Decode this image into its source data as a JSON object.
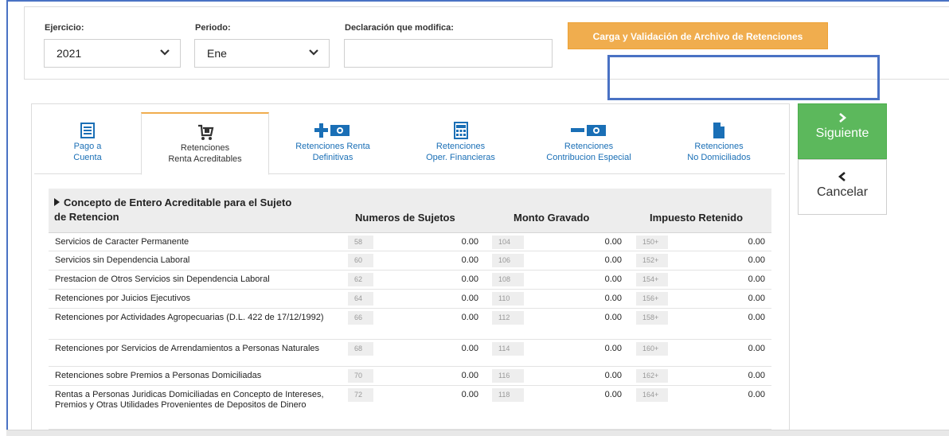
{
  "filters": {
    "ejercicio_label": "Ejercicio:",
    "ejercicio_value": "2021",
    "periodo_label": "Periodo:",
    "periodo_value": "Ene",
    "declaracion_label": "Declaración que modifica:",
    "declaracion_value": "",
    "carga_button": "Carga y Validación de Archivo de Retenciones"
  },
  "tabs": [
    {
      "line1": "Pago a",
      "line2": "Cuenta",
      "icon": "list-icon",
      "active": false
    },
    {
      "line1": "Retenciones",
      "line2": "Renta Acreditables",
      "icon": "cart-icon",
      "active": true
    },
    {
      "line1": "Retenciones Renta",
      "line2": "Definitivas",
      "icon": "plus-money-icon",
      "active": false
    },
    {
      "line1": "Retenciones",
      "line2": "Oper. Financieras",
      "icon": "calculator-icon",
      "active": false
    },
    {
      "line1": "Retenciones",
      "line2": "Contribucion Especial",
      "icon": "minus-money-icon",
      "active": false
    },
    {
      "line1": "Retenciones",
      "line2": "No Domiciliados",
      "icon": "file-icon",
      "active": false
    }
  ],
  "actions": {
    "next": "Siguiente",
    "cancel": "Cancelar"
  },
  "table": {
    "concept_header_1": "Concepto de Entero Acreditable para el Sujeto",
    "concept_header_2": "de Retencion",
    "col_sujetos": "Numeros de Sujetos",
    "col_monto": "Monto Gravado",
    "col_impuesto": "Impuesto Retenido",
    "rows": [
      {
        "concept": "Servicios de Caracter Permanente",
        "c1": "58",
        "v1": "0.00",
        "c2": "104",
        "v2": "0.00",
        "c3": "150+",
        "v3": "0.00"
      },
      {
        "concept": "Servicios sin Dependencia Laboral",
        "c1": "60",
        "v1": "0.00",
        "c2": "106",
        "v2": "0.00",
        "c3": "152+",
        "v3": "0.00"
      },
      {
        "concept": "Prestacion de Otros Servicios sin Dependencia Laboral",
        "c1": "62",
        "v1": "0.00",
        "c2": "108",
        "v2": "0.00",
        "c3": "154+",
        "v3": "0.00"
      },
      {
        "concept": "Retenciones por Juicios Ejecutivos",
        "c1": "64",
        "v1": "0.00",
        "c2": "110",
        "v2": "0.00",
        "c3": "156+",
        "v3": "0.00"
      },
      {
        "concept": "Retenciones por Actividades Agropecuarias (D.L. 422 de 17/12/1992)",
        "c1": "66",
        "v1": "0.00",
        "c2": "112",
        "v2": "0.00",
        "c3": "158+",
        "v3": "0.00"
      },
      {
        "concept": "Retenciones por Servicios de Arrendamientos a Personas Naturales",
        "c1": "68",
        "v1": "0.00",
        "c2": "114",
        "v2": "0.00",
        "c3": "160+",
        "v3": "0.00"
      },
      {
        "concept": "Retenciones sobre Premios a Personas Domiciliadas",
        "c1": "70",
        "v1": "0.00",
        "c2": "116",
        "v2": "0.00",
        "c3": "162+",
        "v3": "0.00"
      },
      {
        "concept": "Rentas a Personas Juridicas Domiciliadas en Concepto de Intereses, Premios y Otras Utilidades Provenientes de Depositos de Dinero",
        "c1": "72",
        "v1": "0.00",
        "c2": "118",
        "v2": "0.00",
        "c3": "164+",
        "v3": "0.00"
      }
    ]
  }
}
